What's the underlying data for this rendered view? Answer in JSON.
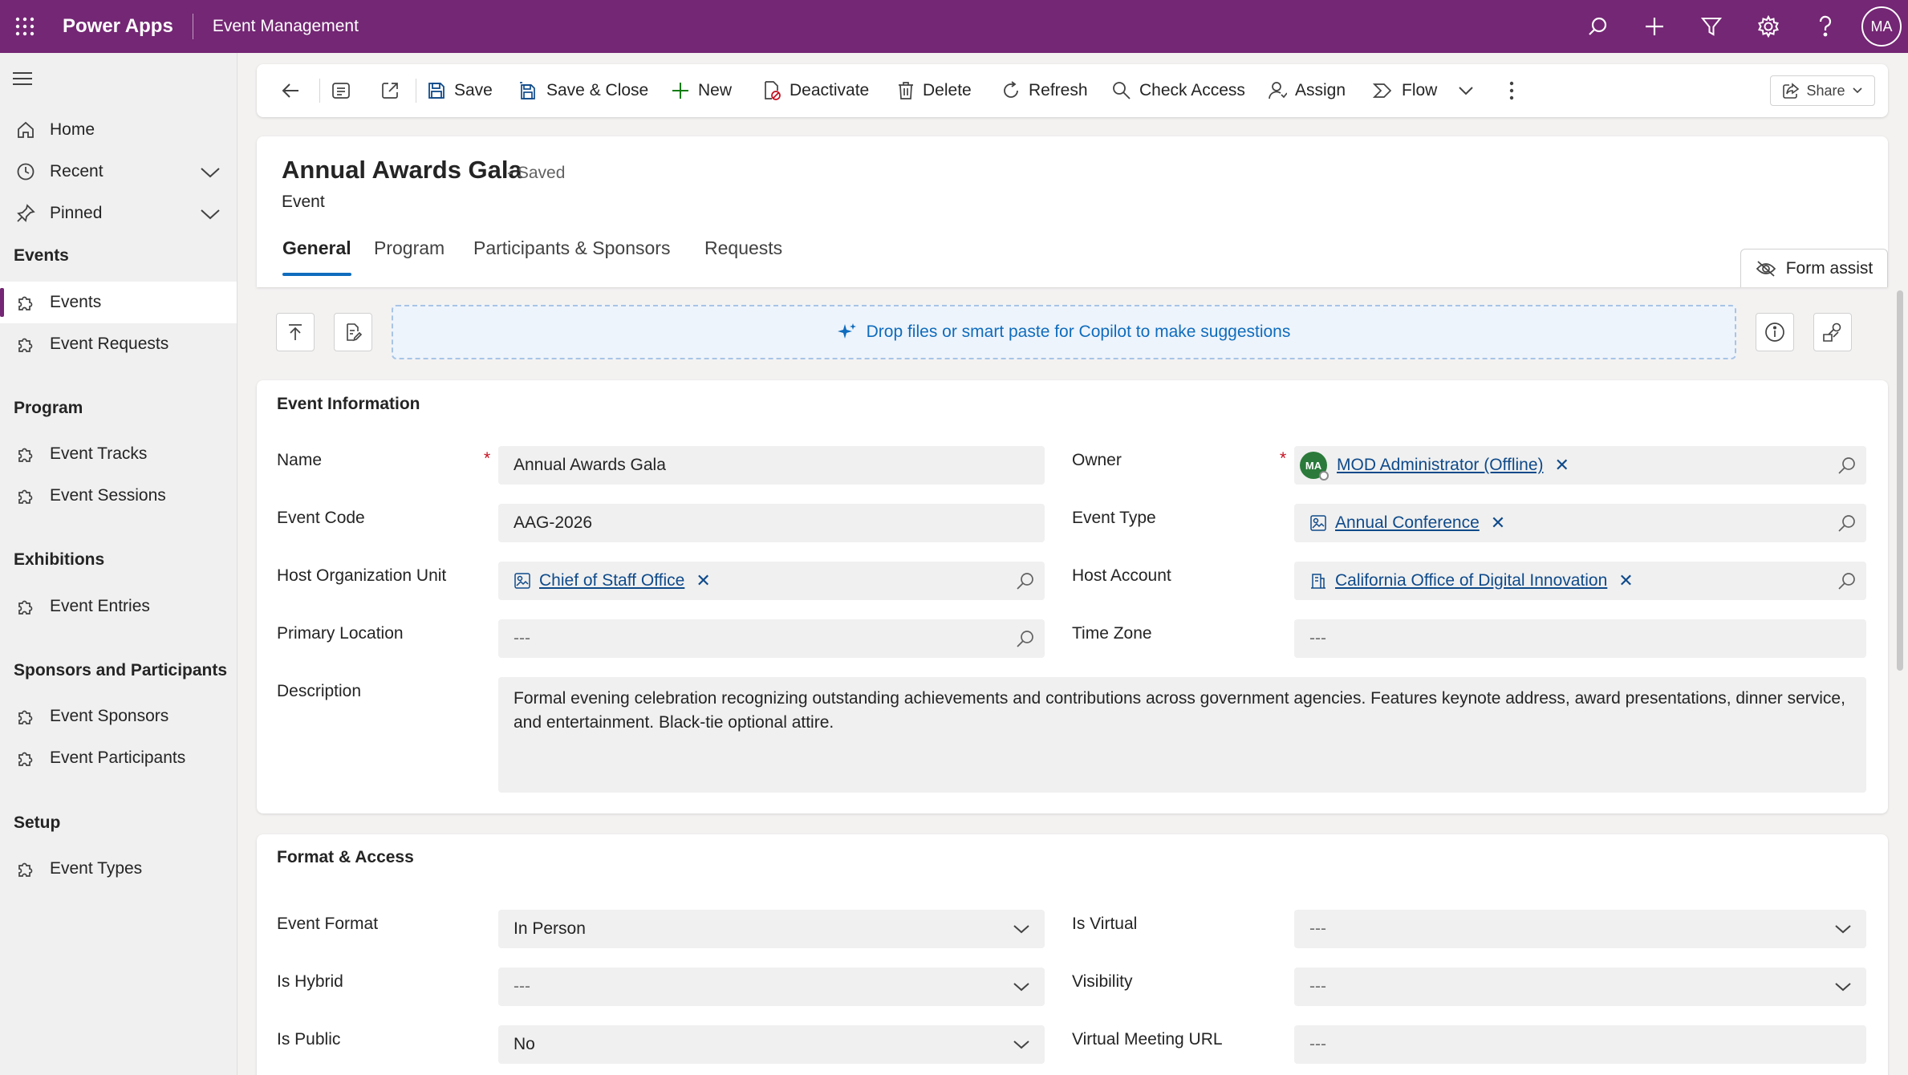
{
  "topbar": {
    "brand": "Power Apps",
    "app_name": "Event Management",
    "avatar_initials": "MA",
    "bg_color": "#742774"
  },
  "sidebar": {
    "top_items": [
      {
        "label": "Home",
        "icon": "home-icon"
      },
      {
        "label": "Recent",
        "icon": "clock-icon"
      },
      {
        "label": "Pinned",
        "icon": "pin-icon"
      }
    ],
    "groups": [
      {
        "title": "Events",
        "items": [
          {
            "label": "Events",
            "active": true
          },
          {
            "label": "Event Requests"
          }
        ]
      },
      {
        "title": "Program",
        "items": [
          {
            "label": "Event Tracks"
          },
          {
            "label": "Event Sessions"
          }
        ]
      },
      {
        "title": "Exhibitions",
        "items": [
          {
            "label": "Event Entries"
          }
        ]
      },
      {
        "title": "Sponsors and Participants",
        "items": [
          {
            "label": "Event Sponsors"
          },
          {
            "label": "Event Participants"
          }
        ]
      },
      {
        "title": "Setup",
        "items": [
          {
            "label": "Event Types"
          }
        ]
      }
    ]
  },
  "commands": {
    "save": "Save",
    "save_close": "Save & Close",
    "new": "New",
    "deactivate": "Deactivate",
    "delete": "Delete",
    "refresh": "Refresh",
    "check_access": "Check Access",
    "assign": "Assign",
    "flow": "Flow",
    "share": "Share"
  },
  "record": {
    "title": "Annual Awards Gala",
    "status": "- Saved",
    "entity": "Event"
  },
  "tabs": [
    "General",
    "Program",
    "Participants & Sponsors",
    "Requests"
  ],
  "form_assist": "Form assist",
  "copilot": {
    "drop_text": "Drop files or smart paste for Copilot to make suggestions"
  },
  "event_info": {
    "title": "Event Information",
    "name_label": "Name",
    "name_value": "Annual Awards Gala",
    "code_label": "Event Code",
    "code_value": "AAG-2026",
    "host_org_label": "Host Organization Unit",
    "host_org_value": "Chief of Staff Office",
    "location_label": "Primary Location",
    "location_value": "---",
    "description_label": "Description",
    "description_value": "Formal evening celebration recognizing outstanding achievements and contributions across government agencies. Features keynote address, award presentations, dinner service, and entertainment. Black-tie optional attire.",
    "owner_label": "Owner",
    "owner_initials": "MA",
    "owner_value": "MOD Administrator (Offline)",
    "type_label": "Event Type",
    "type_value": "Annual Conference",
    "host_account_label": "Host Account",
    "host_account_value": "California Office of Digital Innovation",
    "timezone_label": "Time Zone",
    "timezone_value": "---"
  },
  "format_access": {
    "title": "Format & Access",
    "format_label": "Event Format",
    "format_value": "In Person",
    "hybrid_label": "Is Hybrid",
    "hybrid_value": "---",
    "public_label": "Is Public",
    "public_value": "No",
    "virtual_label": "Is Virtual",
    "virtual_value": "---",
    "visibility_label": "Visibility",
    "visibility_value": "---",
    "meeting_url_label": "Virtual Meeting URL",
    "meeting_url_value": "---"
  }
}
